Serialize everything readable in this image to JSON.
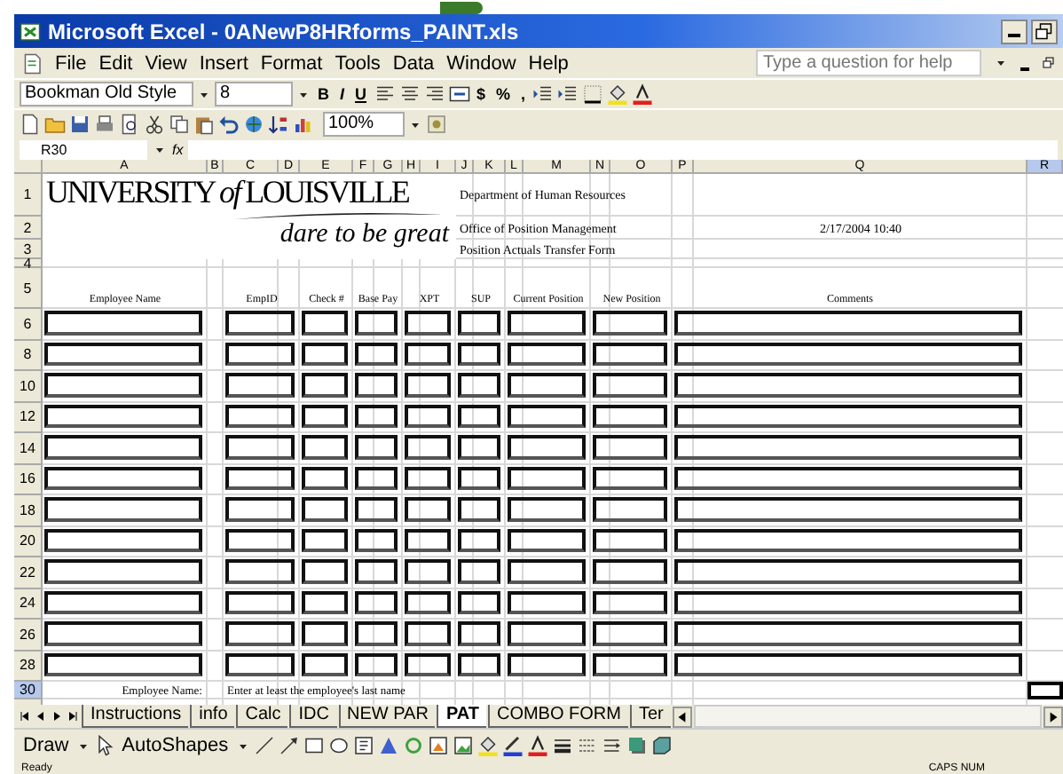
{
  "window": {
    "title": "Microsoft Excel - 0ANewP8HRforms_PAINT.xls"
  },
  "menu": [
    "File",
    "Edit",
    "View",
    "Insert",
    "Format",
    "Tools",
    "Data",
    "Window",
    "Help"
  ],
  "help_search": {
    "placeholder": "Type a question for help"
  },
  "format_toolbar": {
    "font": "Bookman Old Style",
    "size": "8",
    "style_buttons": [
      "B",
      "I",
      "U"
    ],
    "number_buttons": [
      "$",
      "%",
      ","
    ]
  },
  "standard_toolbar": {
    "zoom": "100%"
  },
  "formula_bar": {
    "name_box": "R30",
    "function_label": "fx"
  },
  "columns": [
    {
      "label": "A",
      "selected": false
    },
    {
      "label": "B",
      "selected": false
    },
    {
      "label": "C",
      "selected": false
    },
    {
      "label": "D",
      "selected": false
    },
    {
      "label": "E",
      "selected": false
    },
    {
      "label": "F",
      "selected": false
    },
    {
      "label": "G",
      "selected": false
    },
    {
      "label": "H",
      "selected": false
    },
    {
      "label": "I",
      "selected": false
    },
    {
      "label": "J",
      "selected": false
    },
    {
      "label": "K",
      "selected": false
    },
    {
      "label": "L",
      "selected": false
    },
    {
      "label": "M",
      "selected": false
    },
    {
      "label": "N",
      "selected": false
    },
    {
      "label": "O",
      "selected": false
    },
    {
      "label": "P",
      "selected": false
    },
    {
      "label": "Q",
      "selected": false
    },
    {
      "label": "R",
      "selected": true
    }
  ],
  "sheet": {
    "logo": {
      "name": "UNIVERSITY *of* LOUISVILLE",
      "tagline": "dare to be great"
    },
    "top_rows": [
      "1",
      "2",
      "3",
      "4",
      "5"
    ],
    "header_lines": [
      "Department of Human Resources",
      "Office of Position Management",
      "Position Actuals Transfer Form"
    ],
    "date": "2/17/2004 10:40",
    "table_headers": [
      "Employee Name",
      "EmpID",
      "Check #",
      "Base Pay",
      "XPT",
      "SUP",
      "Current Position",
      "New Position",
      "Comments"
    ],
    "entry_rows": [
      "6",
      "8",
      "10",
      "12",
      "14",
      "16",
      "18",
      "20",
      "22",
      "24",
      "26",
      "28"
    ],
    "note": {
      "row": "30",
      "selected": true,
      "label": "Employee Name:",
      "text": "Enter at least the employee's last name"
    }
  },
  "sheet_tabs": [
    {
      "label": "Instructions",
      "selected": false
    },
    {
      "label": "info",
      "selected": false
    },
    {
      "label": "Calc",
      "selected": false
    },
    {
      "label": "IDC",
      "selected": false
    },
    {
      "label": "NEW PAR",
      "selected": false
    },
    {
      "label": "PAT",
      "selected": true
    },
    {
      "label": "COMBO FORM",
      "selected": false
    },
    {
      "label": "Ter",
      "selected": false
    }
  ],
  "draw_toolbar": {
    "draw": "Draw",
    "autoshapes": "AutoShapes"
  },
  "status_bar": {
    "left": "Ready",
    "right": "CAPS NUM"
  }
}
